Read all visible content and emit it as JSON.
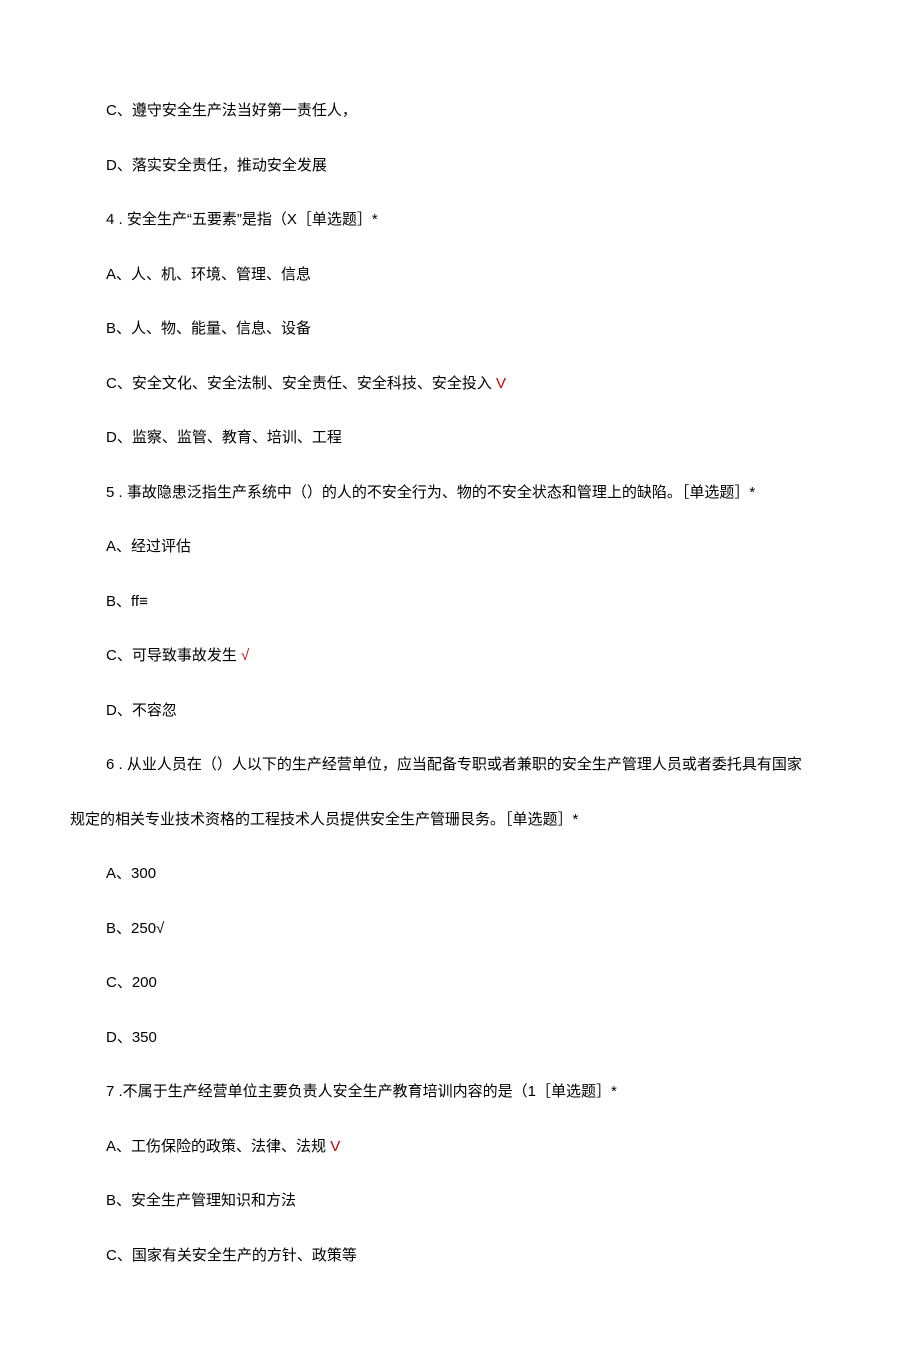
{
  "lines": {
    "l1": "C、遵守安全生产法当好第一责任人，",
    "l2": "D、落实安全责任，推动安全发展",
    "q4": "4  . 安全生产“五要素”是指（X［单选题］*",
    "q4a": "A、人、机、环境、管理、信息",
    "q4b": "B、人、物、能量、信息、设备",
    "q4c": "C、安全文化、安全法制、安全责任、安全科技、安全投入 ",
    "q4c_mark": "V",
    "q4d": "D、监察、监管、教育、培训、工程",
    "q5": "5  . 事故隐患泛指生产系统中（）的人的不安全行为、物的不安全状态和管理上的缺陷。［单选题］*",
    "q5a": "A、经过评估",
    "q5b": "B、ff≡",
    "q5c": "C、可导致事故发生 ",
    "q5c_mark": "√",
    "q5d": "D、不容忽",
    "q6_part1": "6  . 从业人员在（）人以下的生产经营单位，应当配备专职或者兼职的安全生产管理人员或者委托具有国家",
    "q6_part2": "规定的相关专业技术资格的工程技术人员提供安全生产管珊艮务。［单选题］*",
    "q6a": "A、300",
    "q6b": "B、250√",
    "q6c": "C、200",
    "q6d": "D、350",
    "q7": "7  .不属于生产经营单位主要负责人安全生产教育培训内容的是（1［单选题］*",
    "q7a": "A、工伤保险的政策、法律、法规 ",
    "q7a_mark": "V",
    "q7b": "B、安全生产管理知识和方法",
    "q7c": "C、国家有关安全生产的方针、政策等"
  }
}
